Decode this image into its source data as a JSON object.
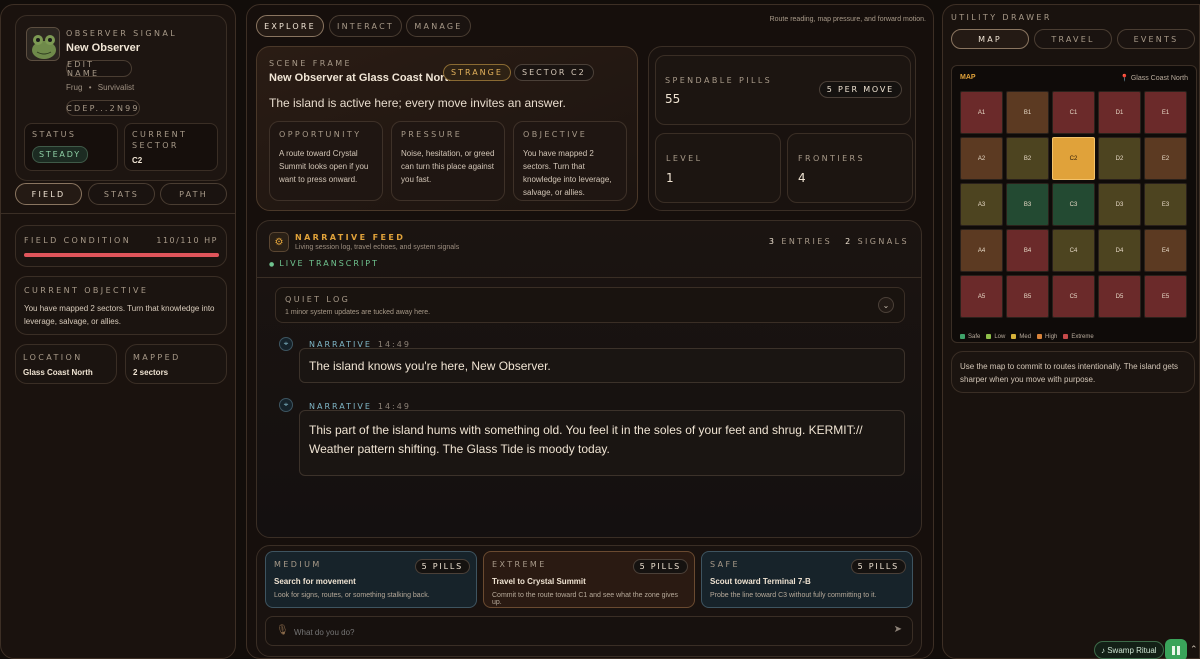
{
  "left": {
    "observer_label": "OBSERVER SIGNAL",
    "observer_name": "New Observer",
    "edit_name": "EDIT NAME",
    "species": "Frug",
    "class": "Survivalist",
    "id_code": "CDEP...2N99",
    "status_label": "STATUS",
    "status_value": "STEADY",
    "sector_label": "CURRENT SECTOR",
    "sector_value": "C2",
    "tabs": [
      "FIELD",
      "STATS",
      "PATH"
    ],
    "field_condition_label": "FIELD CONDITION",
    "hp_value": "110/110 HP",
    "hp_fraction": 1.0,
    "objective_label": "CURRENT OBJECTIVE",
    "objective_text": "You have mapped 2 sectors. Turn that knowledge into leverage, salvage, or allies.",
    "location_label": "LOCATION",
    "location_value": "Glass Coast North",
    "mapped_label": "MAPPED",
    "mapped_value": "2 sectors"
  },
  "center": {
    "tabs": [
      "EXPLORE",
      "INTERACT",
      "MANAGE"
    ],
    "tagline": "Route reading, map pressure, and forward motion.",
    "scene": {
      "label": "SCENE FRAME",
      "title": "New Observer at Glass Coast North",
      "badge_strange": "STRANGE",
      "badge_sector": "SECTOR C2",
      "lead": "The island is active here; every move invites an answer.",
      "cards": [
        {
          "label": "OPPORTUNITY",
          "text": "A route toward Crystal Summit looks open if you want to press onward."
        },
        {
          "label": "PRESSURE",
          "text": "Noise, hesitation, or greed can turn this place against you fast."
        },
        {
          "label": "OBJECTIVE",
          "text": "You have mapped 2 sectors. Turn that knowledge into leverage, salvage, or allies."
        }
      ]
    },
    "stats": {
      "pills_label": "SPENDABLE PILLS",
      "pills_value": "55",
      "per_move": "5 PER MOVE",
      "level_label": "LEVEL",
      "level_value": "1",
      "frontiers_label": "FRONTIERS",
      "frontiers_value": "4"
    },
    "feed": {
      "title": "NARRATIVE FEED",
      "subtitle": "Living session log, travel echoes, and system signals",
      "entries_count": "3",
      "entries_label": "ENTRIES",
      "signals_count": "2",
      "signals_label": "SIGNALS",
      "live": "LIVE TRANSCRIPT",
      "quiet_label": "QUIET LOG",
      "quiet_text": "1 minor system updates are tucked away here.",
      "messages": [
        {
          "label": "NARRATIVE",
          "time": "14:49",
          "text": "The island knows you're here, New Observer."
        },
        {
          "label": "NARRATIVE",
          "time": "14:49",
          "text": "This part of the island hums with something old. You feel it in the soles of your feet and shrug. KERMIT:// Weather pattern shifting. The Glass Tide is moody today."
        }
      ]
    },
    "actions": [
      {
        "risk": "MEDIUM",
        "cost": "5 PILLS",
        "title": "Search for movement",
        "desc": "Look for signs, routes, or something stalking back."
      },
      {
        "risk": "EXTREME",
        "cost": "5 PILLS",
        "title": "Travel to Crystal Summit",
        "desc": "Commit to the route toward C1 and see what the zone gives up."
      },
      {
        "risk": "SAFE",
        "cost": "5 PILLS",
        "title": "Scout toward Terminal 7-B",
        "desc": "Probe the line toward C3 without fully committing to it."
      }
    ],
    "input_placeholder": "What do you do?"
  },
  "right": {
    "title": "UTILITY DRAWER",
    "tabs": [
      "MAP",
      "TRAVEL",
      "EVENTS"
    ],
    "map_label": "MAP",
    "map_location": "Glass Coast North",
    "grid": [
      [
        "A1",
        "#6b2a2a"
      ],
      [
        "B1",
        "#5c3a22"
      ],
      [
        "C1",
        "#6b2a2a"
      ],
      [
        "D1",
        "#6b2a2a"
      ],
      [
        "E1",
        "#6b2a2a"
      ],
      [
        "A2",
        "#5c3a22"
      ],
      [
        "B2",
        "#4d4420"
      ],
      [
        "C2",
        "#e0a23a"
      ],
      [
        "D2",
        "#4d4420"
      ],
      [
        "E2",
        "#5c3a22"
      ],
      [
        "A3",
        "#4d4420"
      ],
      [
        "B3",
        "#234a32"
      ],
      [
        "C3",
        "#234a32"
      ],
      [
        "D3",
        "#4d4420"
      ],
      [
        "E3",
        "#4d4420"
      ],
      [
        "A4",
        "#5c3a22"
      ],
      [
        "B4",
        "#6b2a2a"
      ],
      [
        "C4",
        "#4d4420"
      ],
      [
        "D4",
        "#4d4420"
      ],
      [
        "E4",
        "#5c3a22"
      ],
      [
        "A5",
        "#6b2a2a"
      ],
      [
        "B5",
        "#6b2a2a"
      ],
      [
        "C5",
        "#6b2a2a"
      ],
      [
        "D5",
        "#6b2a2a"
      ],
      [
        "E5",
        "#6b2a2a"
      ]
    ],
    "legend": [
      {
        "name": "Safe",
        "color": "#3fa36a"
      },
      {
        "name": "Low",
        "color": "#8fc04a"
      },
      {
        "name": "Med",
        "color": "#d6b23a"
      },
      {
        "name": "High",
        "color": "#d9833a"
      },
      {
        "name": "Extreme",
        "color": "#c64a4a"
      }
    ],
    "hint": "Use the map to commit to routes intentionally. The island gets sharper when you move with purpose."
  },
  "footer": {
    "ritual": "♪ Swamp Ritual"
  }
}
